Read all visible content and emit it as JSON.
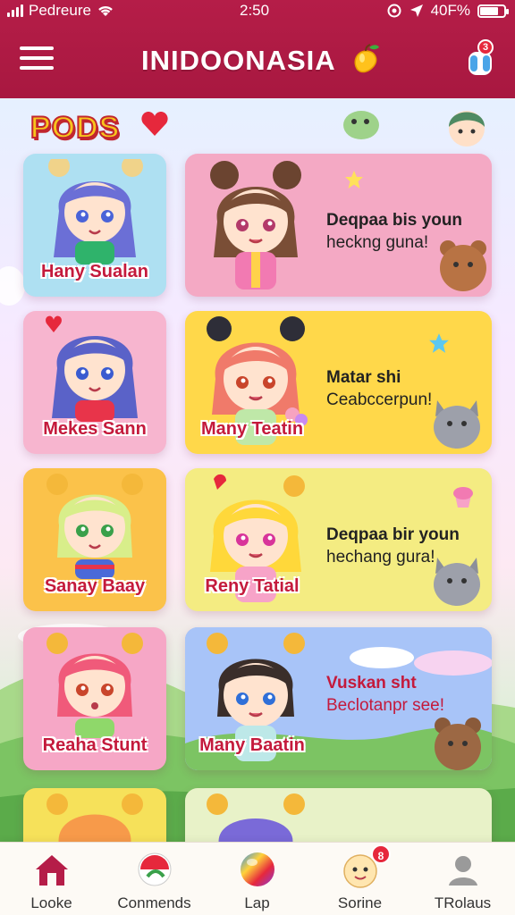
{
  "status_bar": {
    "carrier": "Pedreure",
    "time": "2:50",
    "battery": "40F%",
    "battery_level": 0.7
  },
  "header": {
    "title": "INIDOONASIA",
    "notification_count": "3",
    "icons": [
      "menu-icon",
      "mango-icon",
      "notification-icon"
    ]
  },
  "section": {
    "badge": "PODS"
  },
  "cards": [
    {
      "name": "Hany Sualan",
      "bg": "#aee0f2"
    },
    {
      "name": "",
      "bg": "#f4a9c4",
      "line1": "Deqpaa bis youn",
      "line2": "heckng guna!"
    },
    {
      "name": "Mekes Sann",
      "bg": "#f7b5cf"
    },
    {
      "name": "Many Teatin",
      "bg": "#ffd84a",
      "line1": "Matar shi",
      "line2": "Ceabccerpun!"
    },
    {
      "name": "Sanay Baay",
      "bg": "#fbc24a"
    },
    {
      "name": "Reny Tatial",
      "bg": "#f4ec82",
      "line1": "Deqpaa bir youn",
      "line2": "hechang gura!"
    },
    {
      "name": "Reaha Stunt",
      "bg": "#f6a7c6"
    },
    {
      "name": "Many Baatin",
      "bg": "#9ab8f2",
      "line1": "Vuskan sht",
      "line2": "Beclotanpr see!"
    }
  ],
  "bottom_nav": [
    {
      "label": "Looke",
      "icon": "home-icon"
    },
    {
      "label": "Conmends",
      "icon": "comments-icon"
    },
    {
      "label": "Lap",
      "icon": "ball-icon"
    },
    {
      "label": "Sorine",
      "icon": "face-icon",
      "badge": "8"
    },
    {
      "label": "TRolaus",
      "icon": "profile-icon"
    }
  ],
  "colors": {
    "header": "#b51d48",
    "accent_red": "#c41a3c",
    "nav_bg": "#fdfaf5"
  }
}
